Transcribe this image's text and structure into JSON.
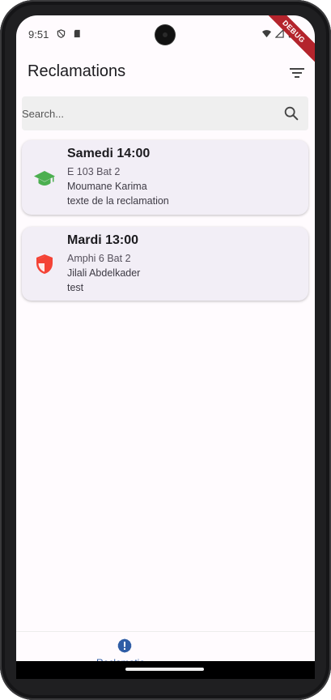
{
  "status_bar": {
    "time": "9:51",
    "icons": [
      "shield-status-icon",
      "sd-card-icon",
      "wifi-icon",
      "signal-icon",
      "battery-icon"
    ]
  },
  "debug_banner": "DEBUG",
  "app_bar": {
    "title": "Reclamations",
    "filter_icon": "filter-icon"
  },
  "search": {
    "placeholder": "Search...",
    "icon": "search-icon"
  },
  "reclamations": [
    {
      "icon": "graduation-cap-icon",
      "icon_color": "#4caf50",
      "title": "Samedi 14:00",
      "location": "E 103 Bat 2",
      "person": "Moumane Karima",
      "text": "texte de la reclamation"
    },
    {
      "icon": "shield-icon",
      "icon_color": "#f44336",
      "title": "Mardi 13:00",
      "location": "Amphi 6 Bat 2",
      "person": "Jilali Abdelkader",
      "text": "test"
    }
  ],
  "bottom_nav": {
    "items": [
      {
        "label": "Reclamatio...",
        "icon": "alert-circle-icon",
        "active": true
      }
    ],
    "active_color": "#2f5da6"
  },
  "colors": {
    "card_background": "#f2eef6",
    "search_background": "#efefef",
    "screen_background": "#fffbfe",
    "debug_banner": "#b4242c"
  }
}
